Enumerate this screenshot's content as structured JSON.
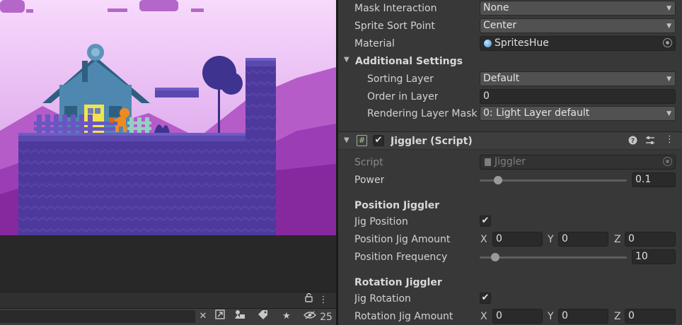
{
  "scene": {
    "colors": {
      "sky_top": "#f5d5fb",
      "sky_bottom": "#d493e6",
      "mountains_back": "#b459c8",
      "mountains_front": "#8c2fa4",
      "ground": "#4d399c",
      "ground_top": "#5e4bb1",
      "house_wall": "#4e88b0",
      "house_roof": "#2f5f80",
      "door": "#f2e44d",
      "character": "#f08a1d"
    }
  },
  "toolbar": {
    "lock_icon": "lock-icon",
    "more_icon": "more-vertical-icon"
  },
  "search_bar": {
    "value": "",
    "hidden_count": "25"
  },
  "inspector": {
    "sprite_renderer": {
      "mask_interaction": {
        "label": "Mask Interaction",
        "value": "None"
      },
      "sprite_sort_point": {
        "label": "Sprite Sort Point",
        "value": "Center"
      },
      "material": {
        "label": "Material",
        "value": "SpritesHue"
      },
      "additional_settings": {
        "label": "Additional Settings"
      },
      "sorting_layer": {
        "label": "Sorting Layer",
        "value": "Default"
      },
      "order_in_layer": {
        "label": "Order in Layer",
        "value": "0"
      },
      "rendering_layer_mask": {
        "label": "Rendering Layer Mask",
        "value": "0: Light Layer default"
      }
    },
    "jiggler": {
      "title": "Jiggler (Script)",
      "enabled": true,
      "script": {
        "label": "Script",
        "value": "Jiggler"
      },
      "power": {
        "label": "Power",
        "value": "0.1",
        "slider_fraction": 0.05
      },
      "position_section": "Position Jiggler",
      "jig_position": {
        "label": "Jig Position",
        "checked": true
      },
      "position_amount": {
        "label": "Position Jig Amount",
        "x_label": "X",
        "x": "0",
        "y_label": "Y",
        "y": "0",
        "z_label": "Z",
        "z": "0"
      },
      "position_frequency": {
        "label": "Position Frequency",
        "value": "10",
        "slider_fraction": 0.02
      },
      "rotation_section": "Rotation Jiggler",
      "jig_rotation": {
        "label": "Jig Rotation",
        "checked": true
      },
      "rotation_amount": {
        "label": "Rotation Jig Amount",
        "x_label": "X",
        "x": "0",
        "y_label": "Y",
        "y": "0",
        "z_label": "Z",
        "z": "0"
      }
    }
  }
}
